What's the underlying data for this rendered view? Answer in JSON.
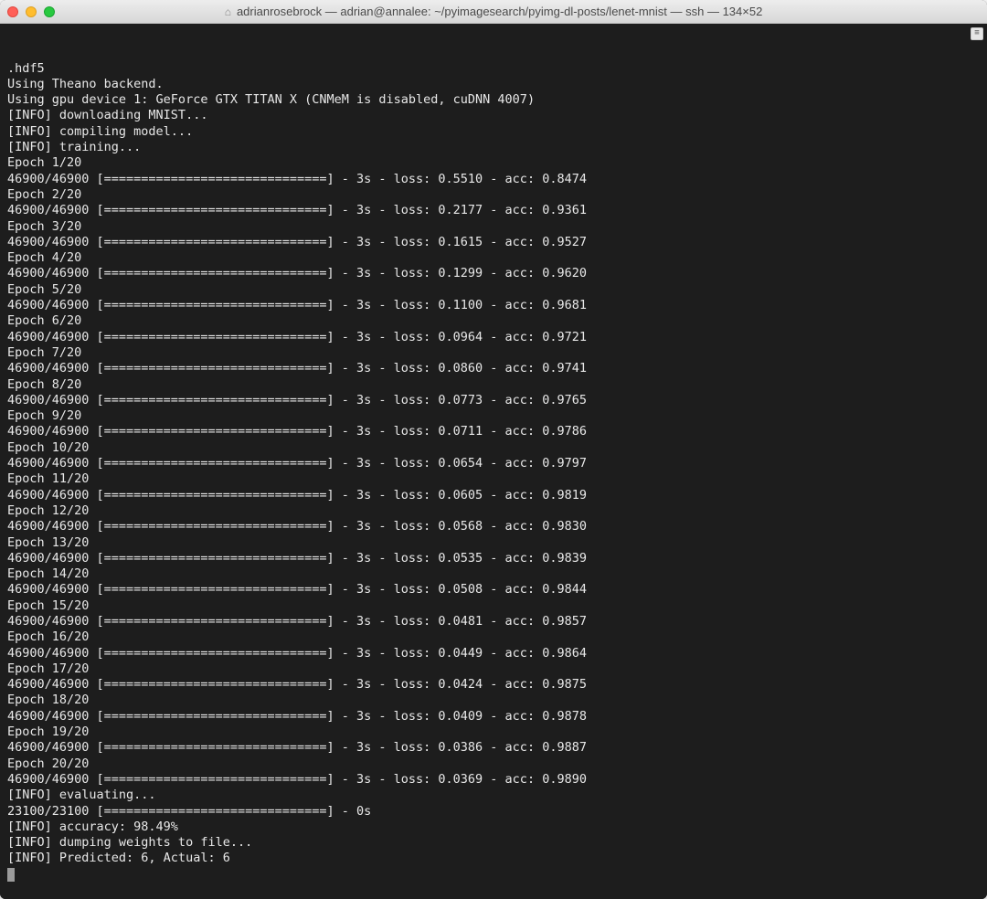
{
  "window": {
    "title": "adrianrosebrock — adrian@annalee: ~/pyimagesearch/pyimg-dl-posts/lenet-mnist — ssh — 134×52"
  },
  "terminal": {
    "pre_lines": [
      ".hdf5",
      "Using Theano backend.",
      "Using gpu device 1: GeForce GTX TITAN X (CNMeM is disabled, cuDNN 4007)",
      "[INFO] downloading MNIST...",
      "[INFO] compiling model...",
      "[INFO] training..."
    ],
    "epochs_total": 20,
    "epochs_done": "46900/46900",
    "epoch_time": "3s",
    "epochs": [
      {
        "n": 1,
        "loss": "0.5510",
        "acc": "0.8474"
      },
      {
        "n": 2,
        "loss": "0.2177",
        "acc": "0.9361"
      },
      {
        "n": 3,
        "loss": "0.1615",
        "acc": "0.9527"
      },
      {
        "n": 4,
        "loss": "0.1299",
        "acc": "0.9620"
      },
      {
        "n": 5,
        "loss": "0.1100",
        "acc": "0.9681"
      },
      {
        "n": 6,
        "loss": "0.0964",
        "acc": "0.9721"
      },
      {
        "n": 7,
        "loss": "0.0860",
        "acc": "0.9741"
      },
      {
        "n": 8,
        "loss": "0.0773",
        "acc": "0.9765"
      },
      {
        "n": 9,
        "loss": "0.0711",
        "acc": "0.9786"
      },
      {
        "n": 10,
        "loss": "0.0654",
        "acc": "0.9797"
      },
      {
        "n": 11,
        "loss": "0.0605",
        "acc": "0.9819"
      },
      {
        "n": 12,
        "loss": "0.0568",
        "acc": "0.9830"
      },
      {
        "n": 13,
        "loss": "0.0535",
        "acc": "0.9839"
      },
      {
        "n": 14,
        "loss": "0.0508",
        "acc": "0.9844"
      },
      {
        "n": 15,
        "loss": "0.0481",
        "acc": "0.9857"
      },
      {
        "n": 16,
        "loss": "0.0449",
        "acc": "0.9864"
      },
      {
        "n": 17,
        "loss": "0.0424",
        "acc": "0.9875"
      },
      {
        "n": 18,
        "loss": "0.0409",
        "acc": "0.9878"
      },
      {
        "n": 19,
        "loss": "0.0386",
        "acc": "0.9887"
      },
      {
        "n": 20,
        "loss": "0.0369",
        "acc": "0.9890"
      }
    ],
    "post_lines": [
      "[INFO] evaluating..."
    ],
    "eval_done": "23100/23100",
    "eval_time": "0s",
    "final_lines": [
      "[INFO] accuracy: 98.49%",
      "[INFO] dumping weights to file...",
      "[INFO] Predicted: 6, Actual: 6"
    ],
    "bar_inner_width": 30
  }
}
